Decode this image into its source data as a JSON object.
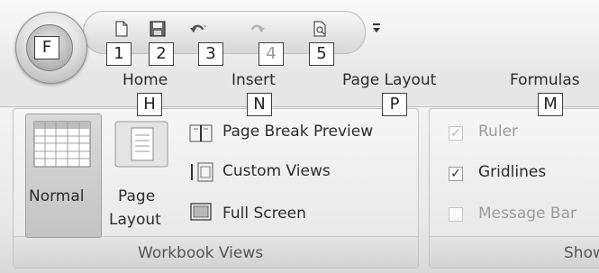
{
  "office_button": {
    "keytip": "F"
  },
  "quick_access": [
    {
      "icon": "new-document-icon",
      "keytip": "1",
      "enabled": true
    },
    {
      "icon": "save-icon",
      "keytip": "2",
      "enabled": true
    },
    {
      "icon": "undo-icon",
      "keytip": "3",
      "enabled": true
    },
    {
      "icon": "redo-icon",
      "keytip": "4",
      "enabled": false
    },
    {
      "icon": "print-preview-icon",
      "keytip": "5",
      "enabled": true
    }
  ],
  "customize_qat_icon": "customize-dropdown-icon",
  "tabs": [
    {
      "label": "Home",
      "keytip": "H"
    },
    {
      "label": "Insert",
      "keytip": "N"
    },
    {
      "label": "Page Layout",
      "keytip": "P"
    },
    {
      "label": "Formulas",
      "keytip": "M"
    }
  ],
  "workbook_views": {
    "group_label": "Workbook Views",
    "normal_label": "Normal",
    "page_layout_label_1": "Page",
    "page_layout_label_2": "Layout",
    "page_break_preview": "Page Break Preview",
    "custom_views": "Custom Views",
    "full_screen": "Full Screen"
  },
  "show_hide": {
    "group_label": "Show",
    "ruler": {
      "label": "Ruler",
      "checked": true,
      "enabled": false
    },
    "gridlines": {
      "label": "Gridlines",
      "checked": true,
      "enabled": true
    },
    "message_bar": {
      "label": "Message Bar",
      "checked": false,
      "enabled": false
    }
  }
}
